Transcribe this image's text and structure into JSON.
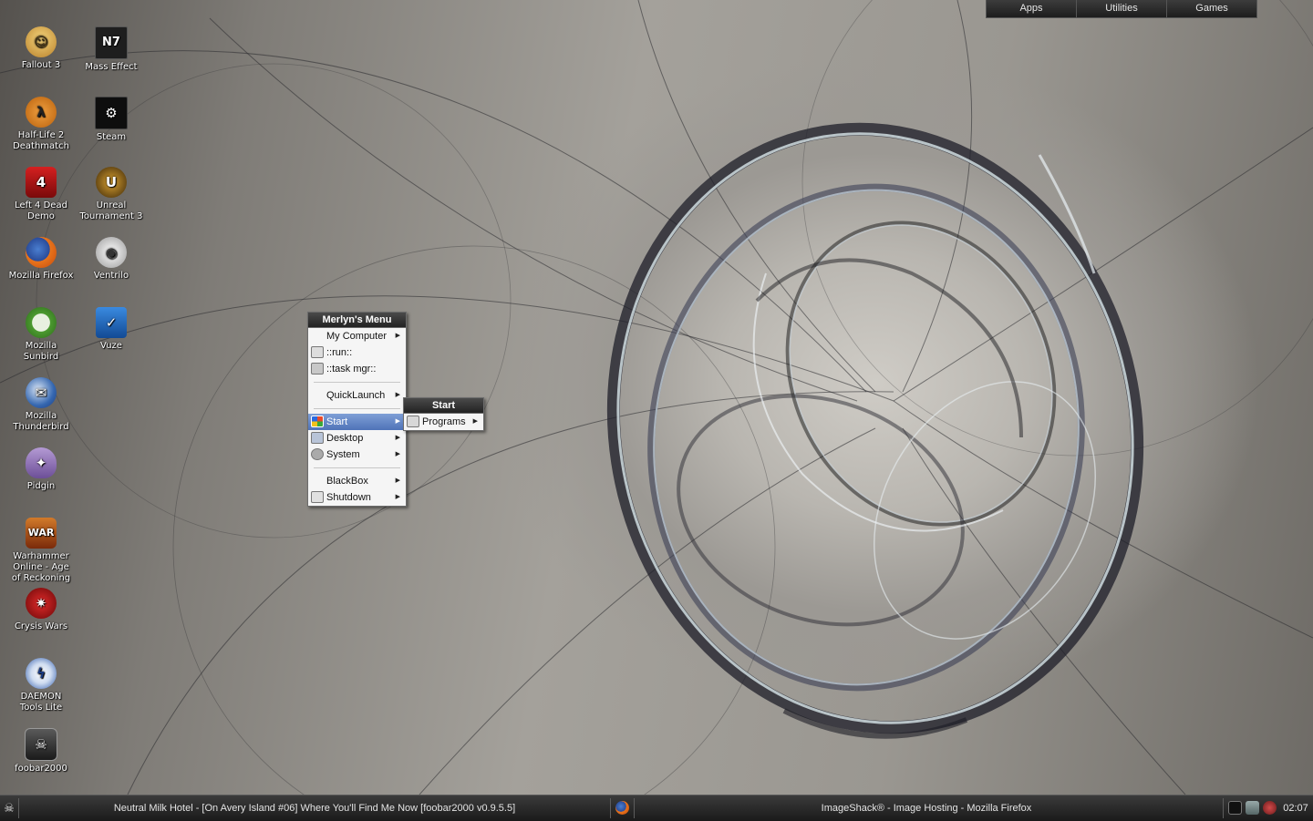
{
  "top_toolbar": {
    "buttons": [
      "Apps",
      "Utilities",
      "Games"
    ]
  },
  "desktop_icons": [
    {
      "label": "Fallout 3",
      "icon": "fallout-vaultboy-icon",
      "color": "#d2a34a"
    },
    {
      "label": "Mass Effect",
      "icon": "n7-icon",
      "color": "#2b2b2b"
    },
    {
      "label": "Half-Life 2 Deathmatch",
      "icon": "lambda-icon",
      "color": "#d8801e"
    },
    {
      "label": "Steam",
      "icon": "steam-icon",
      "color": "#161616"
    },
    {
      "label": "Left 4 Dead Demo",
      "icon": "l4d-icon",
      "color": "#b11414"
    },
    {
      "label": "Unreal Tournament 3",
      "icon": "unreal-icon",
      "color": "#6b4a14"
    },
    {
      "label": "Mozilla Firefox",
      "icon": "firefox-icon",
      "color": "#e8741c"
    },
    {
      "label": "Ventrilo",
      "icon": "ventrilo-icon",
      "color": "#d9d9d9"
    },
    {
      "label": "Mozilla Sunbird",
      "icon": "sunbird-icon",
      "color": "#5a9e3a"
    },
    {
      "label": "Vuze",
      "icon": "vuze-icon",
      "color": "#1e6bc4"
    },
    {
      "label": "Mozilla Thunderbird",
      "icon": "thunderbird-icon",
      "color": "#3567b0"
    },
    {
      "label": "Pidgin",
      "icon": "pidgin-icon",
      "color": "#8a6bb0"
    },
    {
      "label": "Warhammer Online - Age of Reckoning",
      "icon": "war-icon",
      "color": "#a8401a"
    },
    {
      "label": "Crysis Wars",
      "icon": "crysis-icon",
      "color": "#b31515"
    },
    {
      "label": "DAEMON Tools Lite",
      "icon": "daemon-tools-icon",
      "color": "#2a56a8"
    },
    {
      "label": "foobar2000",
      "icon": "foobar-icon",
      "color": "#3a3a3a"
    }
  ],
  "main_menu": {
    "title": "Merlyn's Menu",
    "items": [
      {
        "label": "My Computer",
        "submenu": true,
        "icon": ""
      },
      {
        "label": "::run::",
        "submenu": false,
        "icon": "run-icon"
      },
      {
        "label": "::task mgr::",
        "submenu": false,
        "icon": "task-manager-icon"
      },
      {
        "label": "QuickLaunch",
        "submenu": true,
        "icon": ""
      },
      {
        "label": "Start",
        "submenu": true,
        "icon": "windows-flag-icon",
        "active": true
      },
      {
        "label": "Desktop",
        "submenu": true,
        "icon": "desktop-icon"
      },
      {
        "label": "System",
        "submenu": true,
        "icon": "system-icon"
      },
      {
        "label": "BlackBox",
        "submenu": true,
        "icon": ""
      },
      {
        "label": "Shutdown",
        "submenu": true,
        "icon": "shutdown-icon"
      }
    ]
  },
  "start_submenu": {
    "title": "Start",
    "items": [
      {
        "label": "Programs",
        "submenu": true,
        "icon": "programs-folder-icon"
      }
    ]
  },
  "taskbar": {
    "now_playing": "Neutral Milk Hotel - [On Avery Island #06] Where You'll Find Me Now   [foobar2000 v0.9.5.5]",
    "active_window": "ImageShack® - Image Hosting - Mozilla Firefox",
    "clock": "02:07"
  },
  "colors": {
    "menu_highlight": "#5a7cc0",
    "taskbar": "#2a2a2a"
  }
}
